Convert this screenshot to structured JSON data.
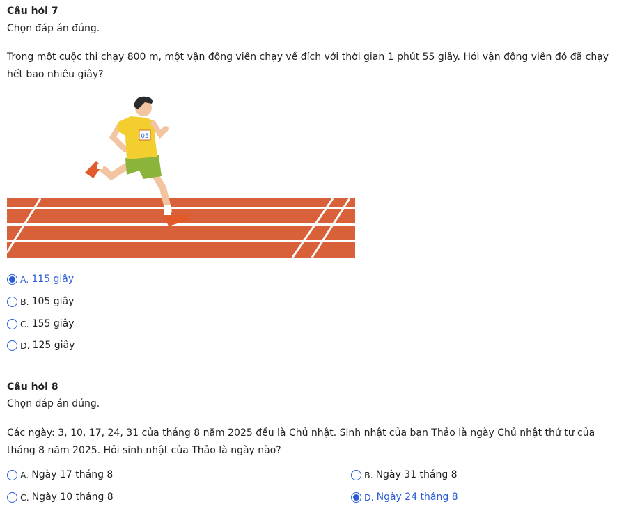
{
  "q7": {
    "title": "Câu hỏi 7",
    "instruction": "Chọn đáp án đúng.",
    "body": "Trong một cuộc thi chạy 800 m, một vận động viên chạy về đích với thời gian 1 phút 55 giây. Hỏi vận động viên đó đã chạy hết bao nhiêu giây?",
    "bib": "05",
    "options": [
      {
        "letter": "A.",
        "text": "115 giây",
        "selected": true
      },
      {
        "letter": "B.",
        "text": "105 giây",
        "selected": false
      },
      {
        "letter": "C.",
        "text": "155 giây",
        "selected": false
      },
      {
        "letter": "D.",
        "text": "125 giây",
        "selected": false
      }
    ]
  },
  "q8": {
    "title": "Câu hỏi 8",
    "instruction": "Chọn đáp án đúng.",
    "body": "Các ngày: 3, 10, 17, 24, 31 của tháng 8 năm 2025 đều là Chủ nhật. Sinh nhật của bạn Thảo là ngày Chủ nhật thứ tư của tháng 8 năm 2025. Hỏi sinh nhật của Thảo là ngày nào?",
    "options": [
      {
        "letter": "A.",
        "text": "Ngày 17 tháng 8",
        "selected": false
      },
      {
        "letter": "B.",
        "text": "Ngày 31 tháng 8",
        "selected": false
      },
      {
        "letter": "C.",
        "text": "Ngày 10 tháng 8",
        "selected": false
      },
      {
        "letter": "D.",
        "text": "Ngày 24 tháng 8",
        "selected": true
      }
    ]
  },
  "colors": {
    "accent": "#2a5bd7",
    "track": "#d9613a",
    "shirt": "#f2cf2e",
    "shorts": "#8bb43a"
  }
}
